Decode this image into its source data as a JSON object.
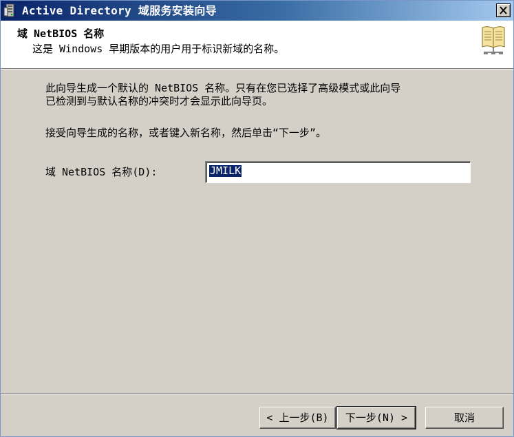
{
  "window": {
    "title": "Active Directory 域服务安装向导"
  },
  "header": {
    "title": "域 NetBIOS 名称",
    "subtitle": "这是 Windows 早期版本的用户用于标识新域的名称。"
  },
  "body": {
    "paragraph1": "此向导生成一个默认的 NetBIOS 名称。只有在您已选择了高级模式或此向导\n已检测到与默认名称的冲突时才会显示此向导页。",
    "paragraph2": "接受向导生成的名称，或者键入新名称，然后单击“下一步”。",
    "field_label": "域 NetBIOS 名称(D):",
    "field_value": "JMILK"
  },
  "buttons": {
    "back": "< 上一步(B)",
    "next": "下一步(N) >",
    "cancel": "取消"
  },
  "icons": {
    "title": "server-wizard-icon",
    "close": "close-icon",
    "header": "book-network-icon"
  },
  "colors": {
    "titlebar_start": "#0a246a",
    "titlebar_end": "#a6caf0",
    "dialog_bg": "#d4d0c8",
    "selection": "#0a246a"
  }
}
